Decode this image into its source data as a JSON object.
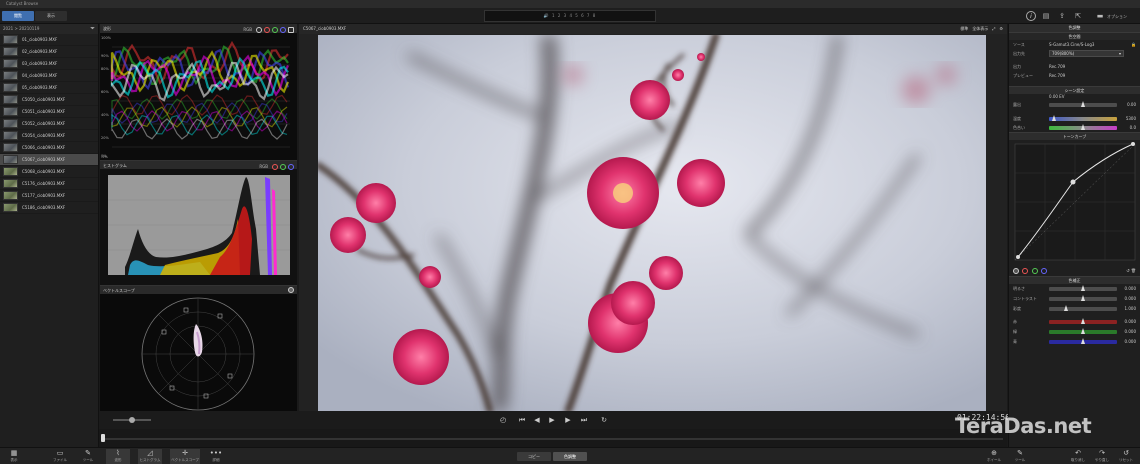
{
  "window": {
    "title": "Catalyst Browse"
  },
  "toolbar": {
    "tabs": [
      "閲覧",
      "表示"
    ],
    "audio_meter": "1 2 3 4 5 6 7 8",
    "option_label": "オプション"
  },
  "library": {
    "path": "2021 > 20210119",
    "clips": [
      {
        "name": "01_ciob0903.MXF",
        "selected": false
      },
      {
        "name": "02_ciob0903.MXF",
        "selected": false
      },
      {
        "name": "03_ciob0903.MXF",
        "selected": false
      },
      {
        "name": "04_ciob0903.MXF",
        "selected": false
      },
      {
        "name": "05_ciob0903.MXF",
        "selected": false
      },
      {
        "name": "C5050_ciob0903.MXF",
        "selected": false
      },
      {
        "name": "C5051_ciob0903.MXF",
        "selected": false
      },
      {
        "name": "C5052_ciob0903.MXF",
        "selected": false
      },
      {
        "name": "C5054_ciob0903.MXF",
        "selected": false
      },
      {
        "name": "C5066_ciob0903.MXF",
        "selected": false
      },
      {
        "name": "C5067_ciob0903.MXF",
        "selected": true
      },
      {
        "name": "C5068_ciob0903.MXF",
        "selected": false
      },
      {
        "name": "C5176_ciob0903.MXF",
        "selected": false
      },
      {
        "name": "C5177_ciob0903.MXF",
        "selected": false
      },
      {
        "name": "C5186_ciob0903.MXF",
        "selected": false
      }
    ]
  },
  "scopes": {
    "waveform": {
      "title": "波形",
      "mode": "RGB",
      "ticks": [
        "100%",
        "90%",
        "80%",
        "60%",
        "40%",
        "20%",
        "0%",
        "-5%"
      ]
    },
    "histogram": {
      "title": "ヒストグラム",
      "mode": "RGB"
    },
    "vectorscope": {
      "title": "ベクトルスコープ"
    }
  },
  "viewer": {
    "clip_name": "C5067_ciob0903.MXF",
    "timecode": "01:22:14:56",
    "view_mode": "標準",
    "zoom": "全体表示"
  },
  "adjust": {
    "title": "色調整",
    "color_space_header": "色空間",
    "source_label": "ソース",
    "source_value": "S-Gamut3.Cine/S-Log3",
    "target_label": "出力先",
    "target_value": "709(800%)",
    "output_label": "出力",
    "output_value": "Rec.709",
    "preview_label": "プレビュー",
    "preview_value": "Rec.709",
    "scene_header": "シーン設定",
    "exposure_label": "露出",
    "exposure_value": "0.00",
    "exposure_unit": "0.00 EV",
    "temp_label": "温度",
    "temp_value": "5300",
    "tint_label": "色合い",
    "tint_value": "0.0",
    "tone_curve_header": "トーンカーブ",
    "color_correction_header": "色補正",
    "sliders": [
      {
        "label": "明るさ",
        "value": "0.000",
        "fraction": 0.5
      },
      {
        "label": "コントラスト",
        "value": "0.000",
        "fraction": 0.5
      },
      {
        "label": "彩度",
        "value": "1.000",
        "fraction": 0.25
      },
      {
        "label": "赤",
        "value": "0.000",
        "fraction": 0.5
      },
      {
        "label": "緑",
        "value": "0.000",
        "fraction": 0.5
      },
      {
        "label": "青",
        "value": "0.000",
        "fraction": 0.5
      }
    ]
  },
  "bottombar": {
    "left": [
      "表示",
      "ファイル",
      "ツール",
      "波形",
      "ヒストグラム",
      "ベクトルスコープ",
      "詳細"
    ],
    "modes": [
      "コピー",
      "色調整"
    ],
    "right": [
      "ホイール",
      "ツール",
      "取り消し",
      "やり直し",
      "リセット"
    ]
  },
  "watermark": "TeraDas.net"
}
